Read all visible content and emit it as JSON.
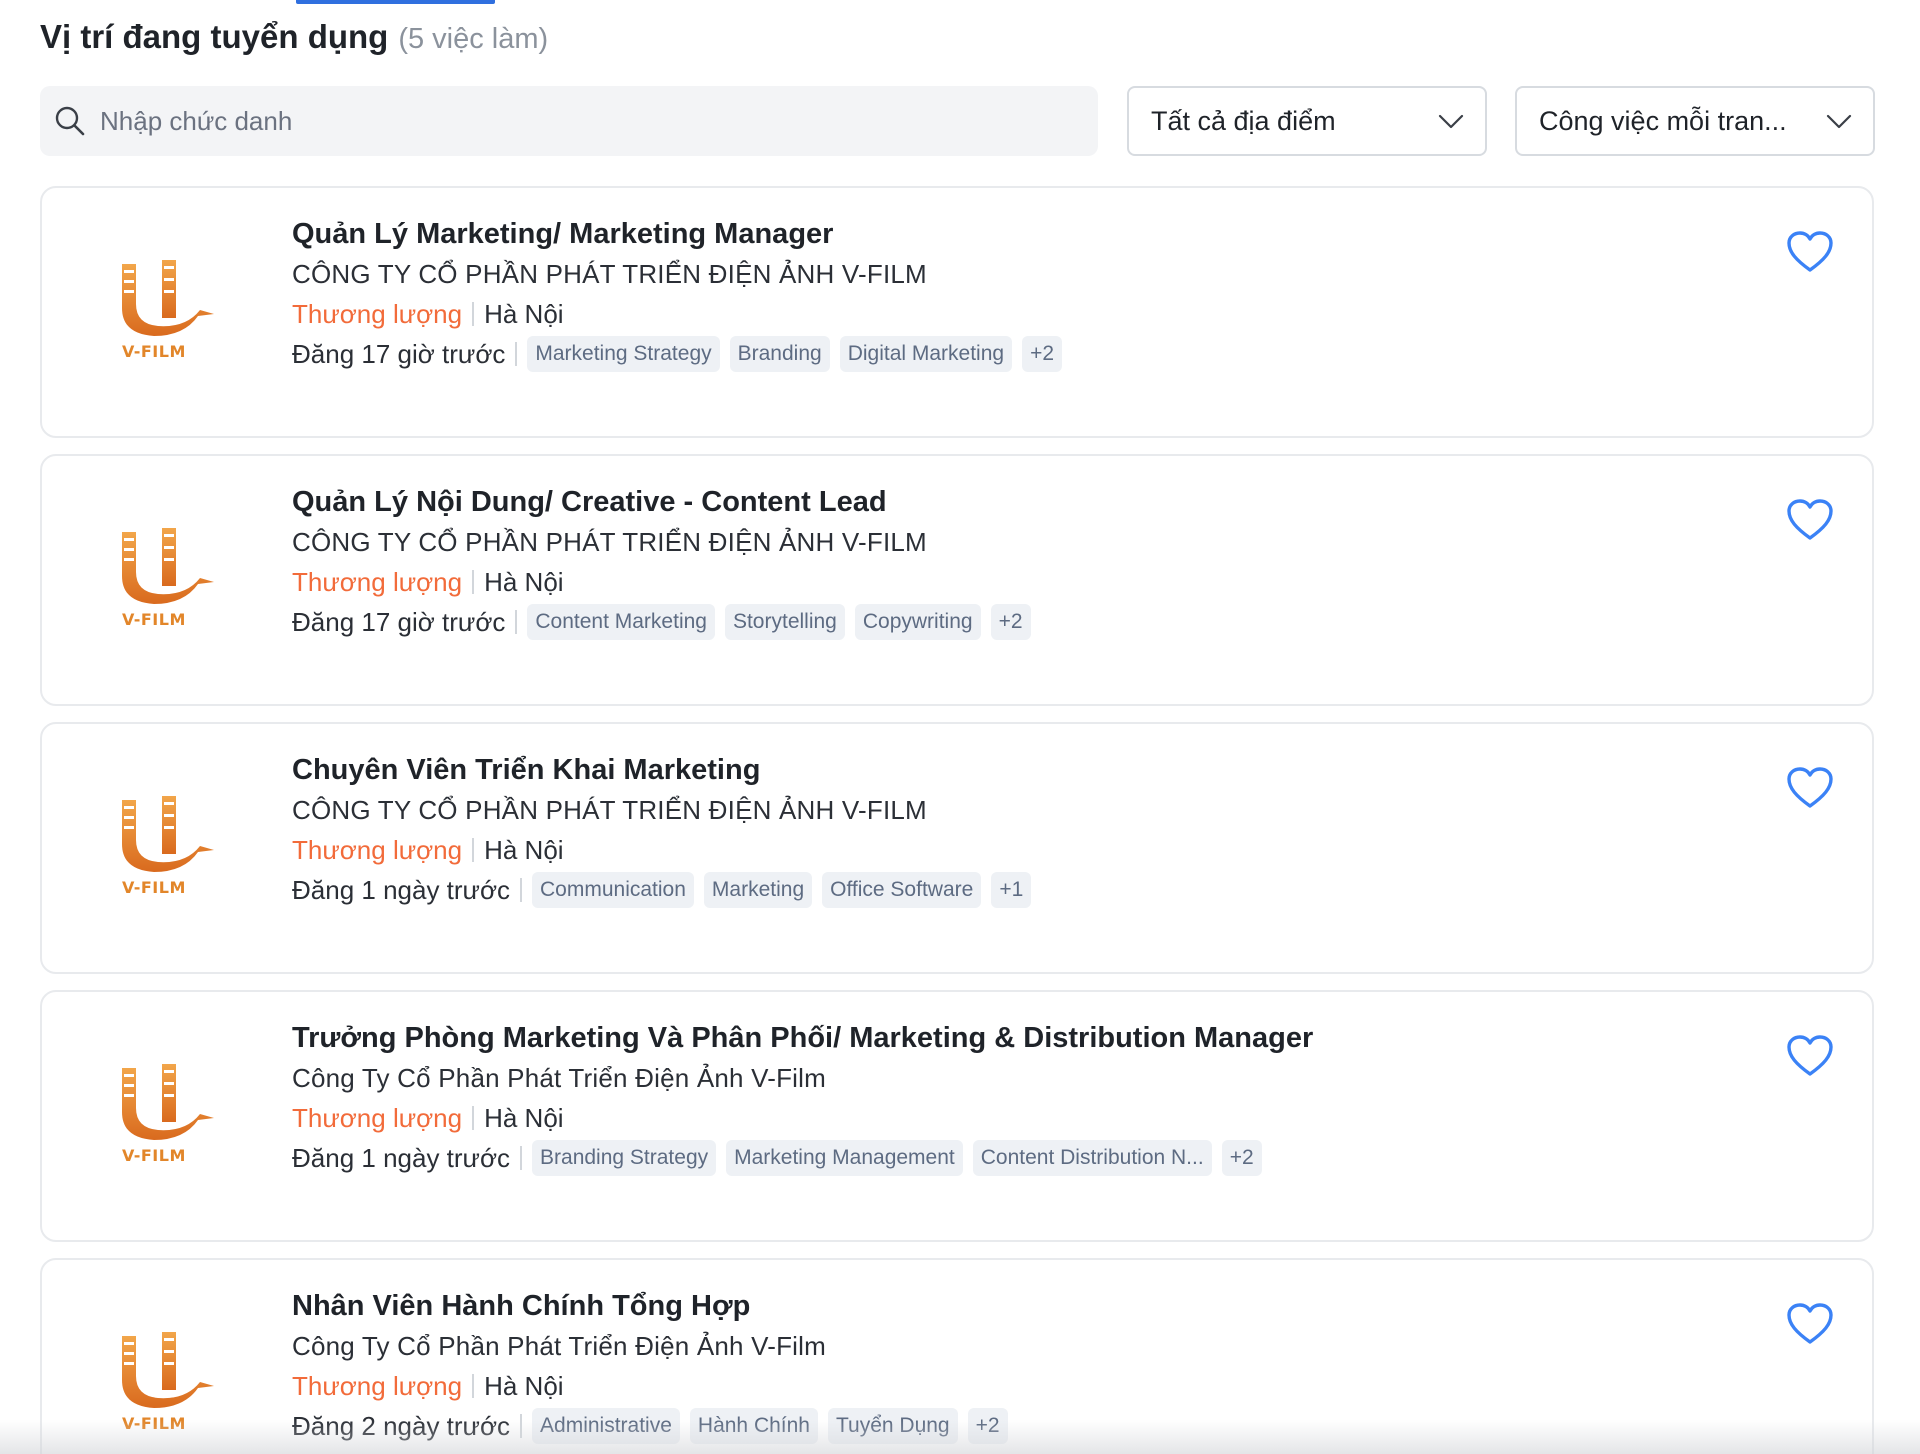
{
  "header": {
    "title": "Vị trí đang tuyển dụng",
    "count": "(5 việc làm)"
  },
  "filters": {
    "search_placeholder": "Nhập chức danh",
    "location_selected": "Tất cả địa điểm",
    "jobtype_selected": "Công việc mỗi tran..."
  },
  "colors": {
    "accent": "#2f6fdf",
    "salary": "#f26b3a",
    "heart": "#3b82f6",
    "logo": "#e2862a"
  },
  "jobs": [
    {
      "title": "Quản Lý Marketing/ Marketing Manager",
      "company": "CÔNG TY CỔ PHẦN PHÁT TRIỂN ĐIỆN ẢNH V-FILM",
      "salary": "Thương lượng",
      "location": "Hà Nội",
      "posted": "Đăng 17 giờ trước",
      "tags": [
        "Marketing Strategy",
        "Branding",
        "Digital Marketing",
        "+2"
      ],
      "logo_text": "V-FILM"
    },
    {
      "title": "Quản Lý Nội Dung/ Creative - Content Lead",
      "company": "CÔNG TY CỔ PHẦN PHÁT TRIỂN ĐIỆN ẢNH V-FILM",
      "salary": "Thương lượng",
      "location": "Hà Nội",
      "posted": "Đăng 17 giờ trước",
      "tags": [
        "Content Marketing",
        "Storytelling",
        "Copywriting",
        "+2"
      ],
      "logo_text": "V-FILM"
    },
    {
      "title": "Chuyên Viên Triển Khai Marketing",
      "company": "CÔNG TY CỔ PHẦN PHÁT TRIỂN ĐIỆN ẢNH V-FILM",
      "salary": "Thương lượng",
      "location": "Hà Nội",
      "posted": "Đăng 1 ngày trước",
      "tags": [
        "Communication",
        "Marketing",
        "Office Software",
        "+1"
      ],
      "logo_text": "V-FILM"
    },
    {
      "title": "Trưởng Phòng Marketing Và Phân Phối/ Marketing & Distribution Manager",
      "company": "Công Ty Cổ Phần Phát Triển Điện Ảnh V-Film",
      "salary": "Thương lượng",
      "location": "Hà Nội",
      "posted": "Đăng 1 ngày trước",
      "tags": [
        "Branding Strategy",
        "Marketing Management",
        "Content Distribution N...",
        "+2"
      ],
      "logo_text": "V-FILM"
    },
    {
      "title": "Nhân Viên Hành Chính Tổng Hợp",
      "company": "Công Ty Cổ Phần Phát Triển Điện Ảnh V-Film",
      "salary": "Thương lượng",
      "location": "Hà Nội",
      "posted": "Đăng 2 ngày trước",
      "tags": [
        "Administrative",
        "Hành Chính",
        "Tuyển Dụng",
        "+2"
      ],
      "logo_text": "V-FILM"
    }
  ]
}
